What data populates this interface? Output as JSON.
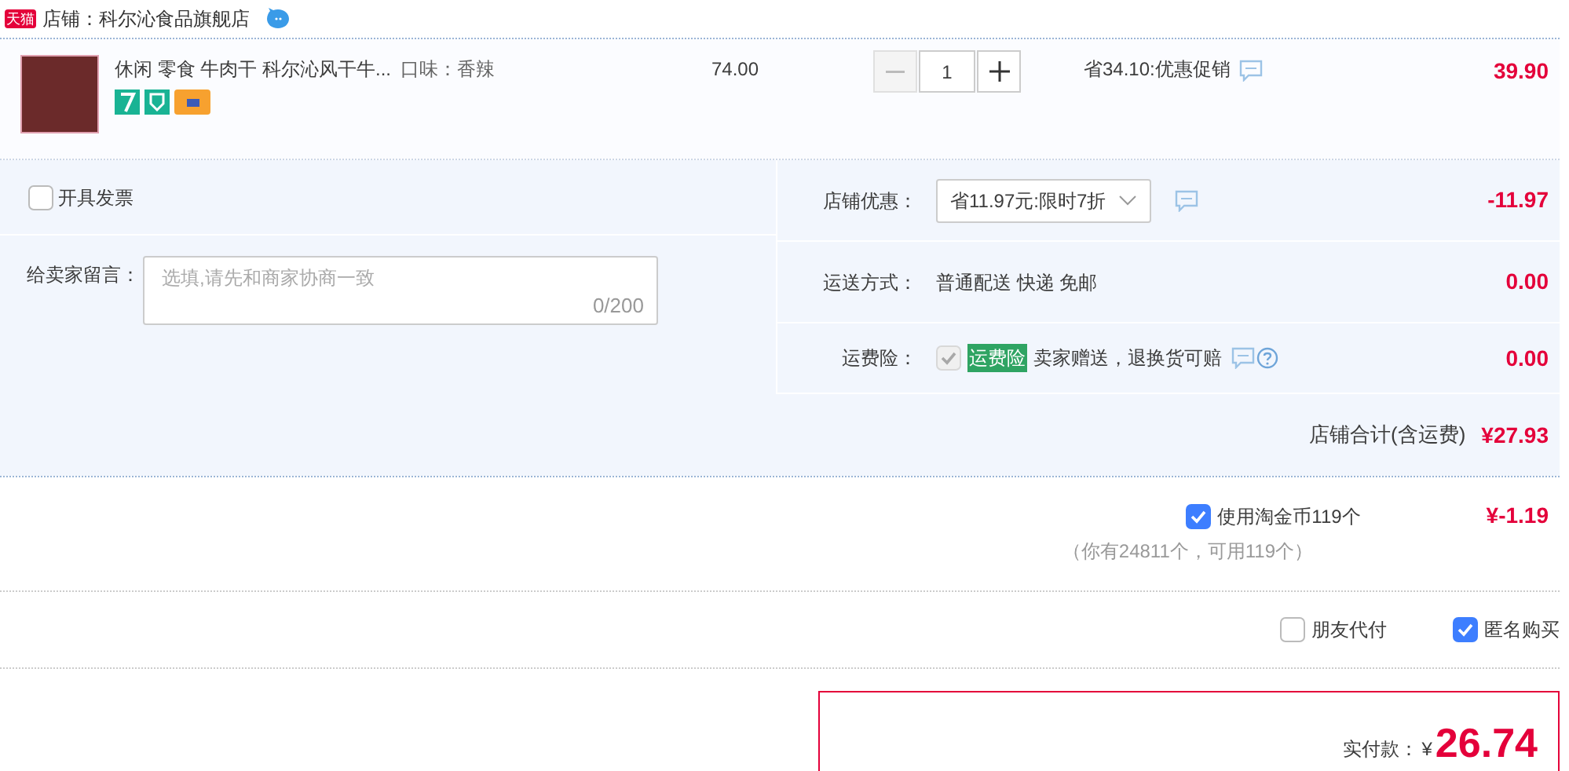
{
  "store": {
    "badge": "天猫",
    "name": "店铺：科尔沁食品旗舰店"
  },
  "item": {
    "title": "休闲 零食 牛肉干 科尔沁风干牛...",
    "spec": "口味：香辣",
    "unit_price": "74.00",
    "quantity": "1",
    "promo": "省34.10:优惠促销",
    "subtotal": "39.90"
  },
  "invoice": {
    "label": "开具发票",
    "checked": false
  },
  "message": {
    "label": "给卖家留言：",
    "placeholder": "选填,请先和商家协商一致",
    "counter": "0/200"
  },
  "store_discount": {
    "label": "店铺优惠：",
    "value": "省11.97元:限时7折",
    "amount": "-11.97"
  },
  "shipping": {
    "label": "运送方式：",
    "value": "普通配送 快递 免邮",
    "amount": "0.00"
  },
  "insurance": {
    "label": "运费险：",
    "checked": true,
    "disabled": true,
    "tag": "运费险",
    "text": "卖家赠送，退换货可赔",
    "amount": "0.00"
  },
  "store_total": {
    "label": "店铺合计(含运费)",
    "amount": "¥27.93"
  },
  "coins": {
    "label": "使用淘金币119个",
    "checked": true,
    "amount": "¥-1.19",
    "note": "（你有24811个，可用119个）"
  },
  "options": [
    {
      "label": "朋友代付",
      "checked": false
    },
    {
      "label": "匿名购买",
      "checked": true
    }
  ],
  "payment": {
    "label": "实付款：",
    "currency": "¥",
    "amount": "26.74"
  }
}
